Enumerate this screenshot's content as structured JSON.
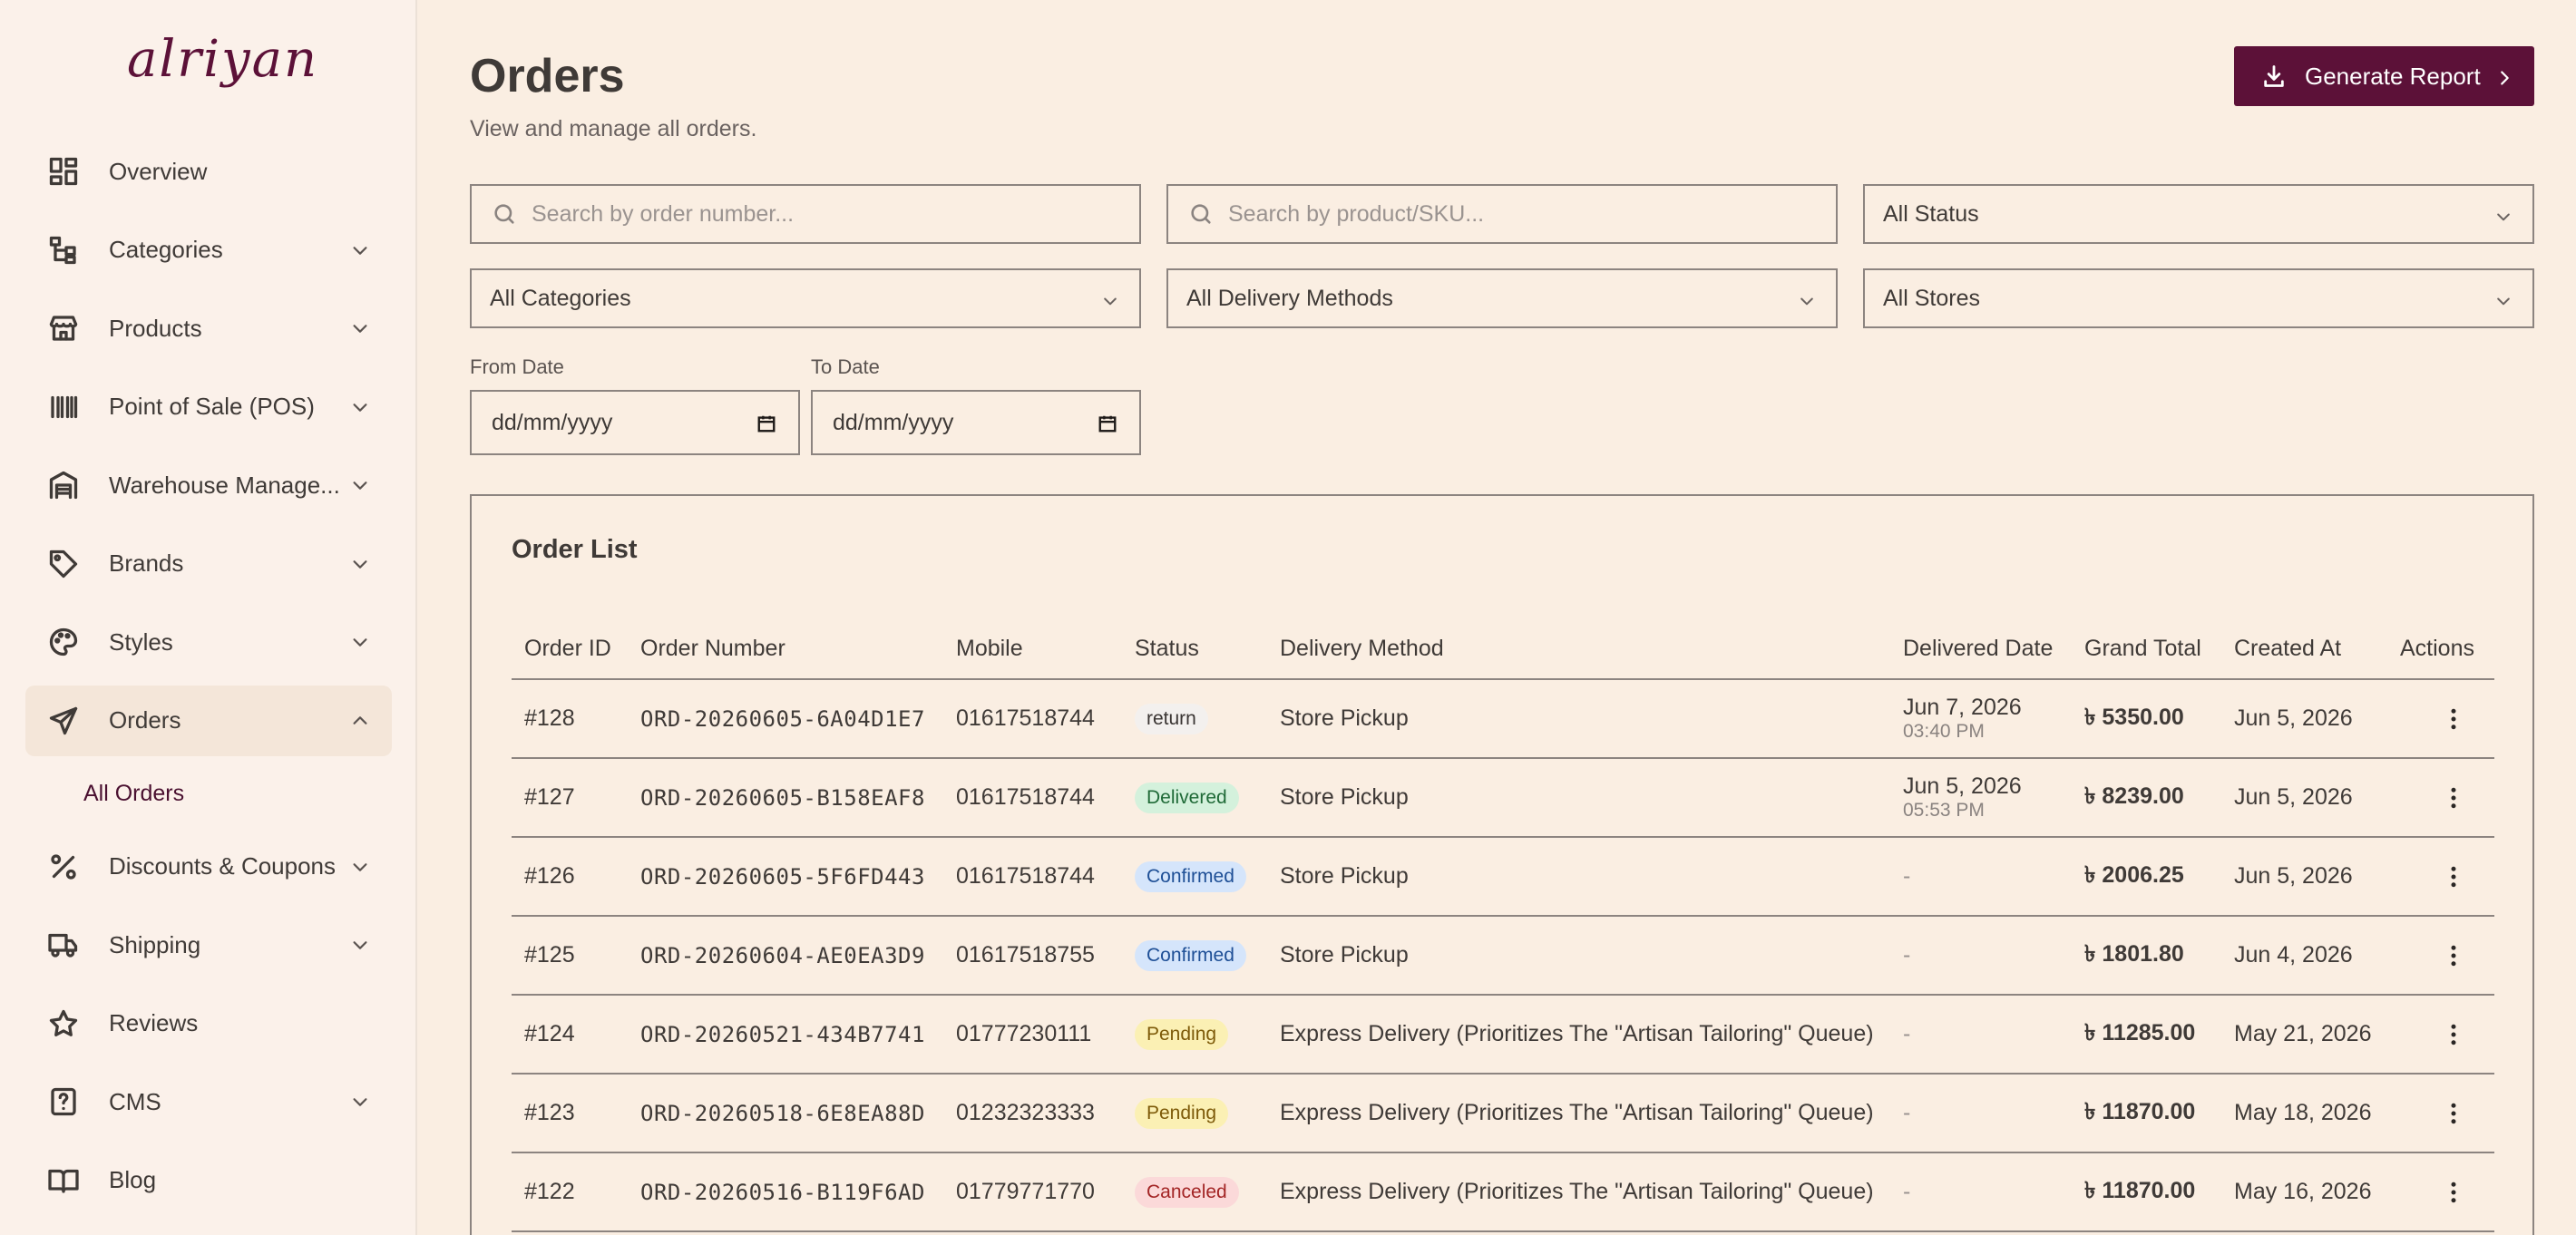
{
  "brand": {
    "logo_text": "alriyan"
  },
  "sidebar": {
    "items": [
      {
        "label": "Overview",
        "icon": "dashboard-icon",
        "expandable": false
      },
      {
        "label": "Categories",
        "icon": "categories-icon",
        "expandable": true
      },
      {
        "label": "Products",
        "icon": "store-icon",
        "expandable": true
      },
      {
        "label": "Point of Sale (POS)",
        "icon": "barcode-icon",
        "expandable": true
      },
      {
        "label": "Warehouse Manage...",
        "icon": "warehouse-icon",
        "expandable": true
      },
      {
        "label": "Brands",
        "icon": "tag-icon",
        "expandable": true
      },
      {
        "label": "Styles",
        "icon": "palette-icon",
        "expandable": true
      },
      {
        "label": "Orders",
        "icon": "send-icon",
        "expandable": true,
        "active": true
      },
      {
        "label": "Discounts & Coupons",
        "icon": "percent-icon",
        "expandable": true
      },
      {
        "label": "Shipping",
        "icon": "truck-icon",
        "expandable": true
      },
      {
        "label": "Reviews",
        "icon": "star-icon",
        "expandable": false
      },
      {
        "label": "CMS",
        "icon": "help-icon",
        "expandable": true
      },
      {
        "label": "Blog",
        "icon": "book-icon",
        "expandable": false
      }
    ],
    "orders_sub": {
      "label": "All Orders"
    }
  },
  "header": {
    "title": "Orders",
    "subtitle": "View and manage all orders.",
    "generate_label": "Generate Report"
  },
  "filters": {
    "order_search_placeholder": "Search by order number...",
    "product_search_placeholder": "Search by product/SKU...",
    "status": "All Status",
    "categories": "All Categories",
    "delivery": "All Delivery Methods",
    "stores": "All Stores",
    "from_label": "From Date",
    "to_label": "To Date",
    "from_value": "dd/mm/yyyy",
    "to_value": "dd/mm/yyyy"
  },
  "orders": {
    "title": "Order List",
    "columns": [
      "Order ID",
      "Order Number",
      "Mobile",
      "Status",
      "Delivery Method",
      "Delivered Date",
      "Grand Total",
      "Created At",
      "Actions"
    ],
    "rows": [
      {
        "id": "#128",
        "number": "ORD-20260605-6A04D1E7",
        "mobile": "01617518744",
        "status": "return",
        "status_class": "b-return",
        "delivery": "Store Pickup",
        "delivered_date": "Jun 7, 2026",
        "delivered_time": "03:40 PM",
        "total": "৳ 5350.00",
        "created": "Jun 5, 2026"
      },
      {
        "id": "#127",
        "number": "ORD-20260605-B158EAF8",
        "mobile": "01617518744",
        "status": "Delivered",
        "status_class": "b-delivered",
        "delivery": "Store Pickup",
        "delivered_date": "Jun 5, 2026",
        "delivered_time": "05:53 PM",
        "total": "৳ 8239.00",
        "created": "Jun 5, 2026"
      },
      {
        "id": "#126",
        "number": "ORD-20260605-5F6FD443",
        "mobile": "01617518744",
        "status": "Confirmed",
        "status_class": "b-confirmed",
        "delivery": "Store Pickup",
        "delivered_date": "-",
        "delivered_time": "",
        "total": "৳ 2006.25",
        "created": "Jun 5, 2026"
      },
      {
        "id": "#125",
        "number": "ORD-20260604-AE0EA3D9",
        "mobile": "01617518755",
        "status": "Confirmed",
        "status_class": "b-confirmed",
        "delivery": "Store Pickup",
        "delivered_date": "-",
        "delivered_time": "",
        "total": "৳ 1801.80",
        "created": "Jun 4, 2026"
      },
      {
        "id": "#124",
        "number": "ORD-20260521-434B7741",
        "mobile": "01777230111",
        "status": "Pending",
        "status_class": "b-pending",
        "delivery": "Express Delivery (Prioritizes The \"Artisan Tailoring\" Queue)",
        "delivered_date": "-",
        "delivered_time": "",
        "total": "৳ 11285.00",
        "created": "May 21, 2026"
      },
      {
        "id": "#123",
        "number": "ORD-20260518-6E8EA88D",
        "mobile": "01232323333",
        "status": "Pending",
        "status_class": "b-pending",
        "delivery": "Express Delivery (Prioritizes The \"Artisan Tailoring\" Queue)",
        "delivered_date": "-",
        "delivered_time": "",
        "total": "৳ 11870.00",
        "created": "May 18, 2026"
      },
      {
        "id": "#122",
        "number": "ORD-20260516-B119F6AD",
        "mobile": "01779771770",
        "status": "Canceled",
        "status_class": "b-canceled",
        "delivery": "Express Delivery (Prioritizes The \"Artisan Tailoring\" Queue)",
        "delivered_date": "-",
        "delivered_time": "",
        "total": "৳ 11870.00",
        "created": "May 16, 2026"
      }
    ]
  },
  "colors": {
    "accent": "#5c1138",
    "background": "#faeee2",
    "sidebar": "#fbf1ea"
  }
}
